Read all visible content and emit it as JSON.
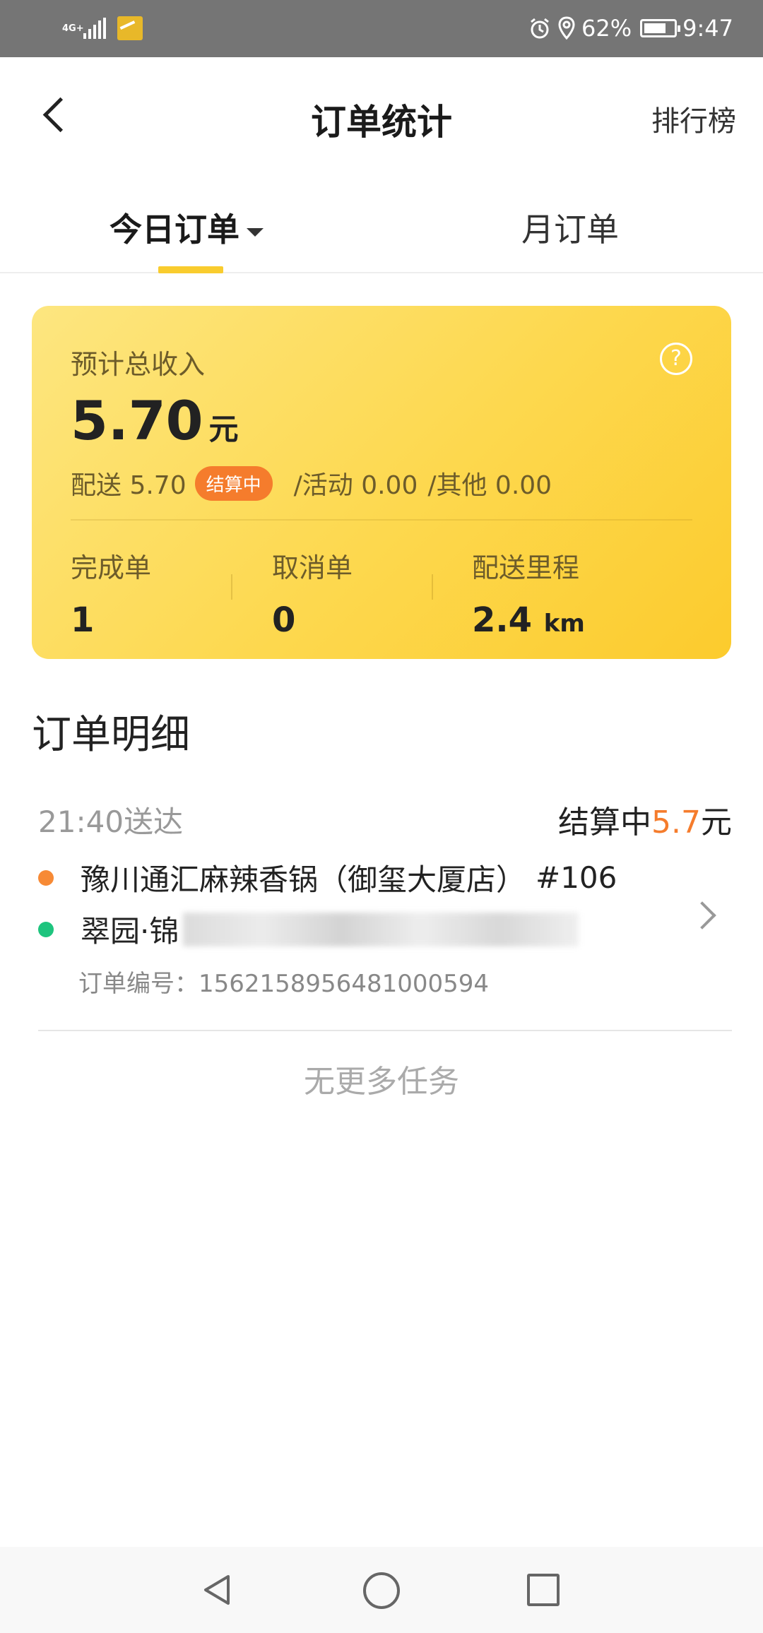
{
  "status_bar": {
    "network": "4G+",
    "battery": "62%",
    "time": "9:47"
  },
  "header": {
    "title": "订单统计",
    "right_action": "排行榜"
  },
  "tabs": {
    "today": "今日订单",
    "month": "月订单",
    "active": "today"
  },
  "income_card": {
    "label": "预计总收入",
    "amount": "5.70",
    "unit": "元",
    "delivery": "配送 5.70",
    "badge": "结算中",
    "activity": "/活动 0.00",
    "other": "/其他 0.00",
    "stats": [
      {
        "label": "完成单",
        "value": "1",
        "unit": ""
      },
      {
        "label": "取消单",
        "value": "0",
        "unit": ""
      },
      {
        "label": "配送里程",
        "value": "2.4",
        "unit": "km"
      }
    ]
  },
  "detail": {
    "title": "订单明细",
    "orders": [
      {
        "time": "21:40送达",
        "status": "结算中",
        "amount": "5.7",
        "currency": "元",
        "shop": "豫川通汇麻辣香锅（御玺大厦店）",
        "shop_no": "#106",
        "destination": "翠园·锦",
        "order_no_label": "订单编号：",
        "order_no": "1562158956481000594"
      }
    ],
    "no_more": "无更多任务"
  },
  "colors": {
    "accent_yellow": "#fcd34d",
    "accent_orange": "#f57c2c",
    "dot_green": "#1ec47e"
  }
}
